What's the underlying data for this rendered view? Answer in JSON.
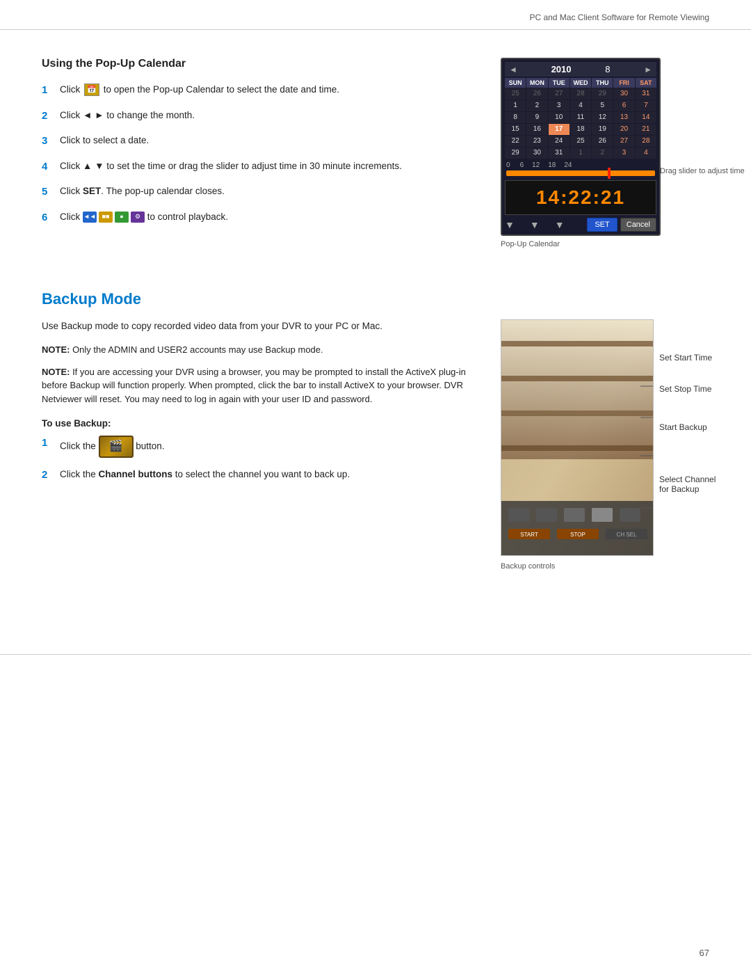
{
  "header": {
    "subtitle": "PC and Mac Client Software for Remote Viewing"
  },
  "popup_section": {
    "title": "Using the Pop-Up Calendar",
    "steps": [
      {
        "num": "1",
        "text_before": "Click ",
        "icon": "calendar-icon",
        "text_after": " to open the Pop-up Calendar to select the date and time."
      },
      {
        "num": "2",
        "text": "Click ◄ ► to change the month."
      },
      {
        "num": "3",
        "text": "Click to select a date."
      },
      {
        "num": "4",
        "text": "Click ▲ ▼ to set the time or drag the slider to adjust time in 30 minute increments."
      },
      {
        "num": "5",
        "text_before": "Click ",
        "bold": "SET",
        "text_after": ". The pop-up calendar closes."
      },
      {
        "num": "6",
        "text_before": "Click ",
        "text_after": " to control playback."
      }
    ],
    "calendar": {
      "year": "2010",
      "month": "8",
      "day_headers": [
        "SUN",
        "MON",
        "TUE",
        "WED",
        "THU",
        "FRI",
        "SAT"
      ],
      "days": [
        [
          "25",
          "26",
          "27",
          "28",
          "29",
          "30",
          "31"
        ],
        [
          "1",
          "2",
          "3",
          "4",
          "5",
          "6",
          "7"
        ],
        [
          "8",
          "9",
          "10",
          "11",
          "12",
          "13",
          "14"
        ],
        [
          "15",
          "16",
          "17",
          "18",
          "19",
          "20",
          "21"
        ],
        [
          "22",
          "23",
          "24",
          "25",
          "26",
          "27",
          "28"
        ],
        [
          "29",
          "30",
          "31",
          "1",
          "2",
          "3",
          "4"
        ]
      ],
      "time": "14:22:21",
      "set_button": "SET",
      "cancel_button": "Cancel",
      "drag_slider_label": "Drag slider to adjust time"
    },
    "calendar_caption": "Pop-Up Calendar"
  },
  "backup_section": {
    "title": "Backup Mode",
    "intro": "Use Backup mode to copy recorded video data from your DVR to your PC or Mac.",
    "note1_label": "NOTE:",
    "note1_text": " Only the ADMIN and USER2 accounts may use Backup mode.",
    "note2_label": "NOTE:",
    "note2_text": " If you are accessing your DVR using a browser, you may be prompted to install the ActiveX plug-in before Backup will function properly. When prompted, click the bar to install ActiveX to your browser. DVR Netviewer will reset. You may need to log in again with your user ID and password.",
    "to_use_title": "To use Backup:",
    "steps": [
      {
        "num": "1",
        "text_before": "Click the ",
        "text_after": " button."
      },
      {
        "num": "2",
        "text_before": "Click the ",
        "bold": "Channel buttons",
        "text_after": " to select the channel you want to back up."
      }
    ],
    "controls_annotations": {
      "set_start_time": "Set Start Time",
      "set_stop_time": "Set Stop Time",
      "start_backup": "Start Backup",
      "select_channel": "Select Channel for Backup"
    },
    "controls_caption": "Backup controls"
  },
  "footer": {
    "page_number": "67"
  }
}
